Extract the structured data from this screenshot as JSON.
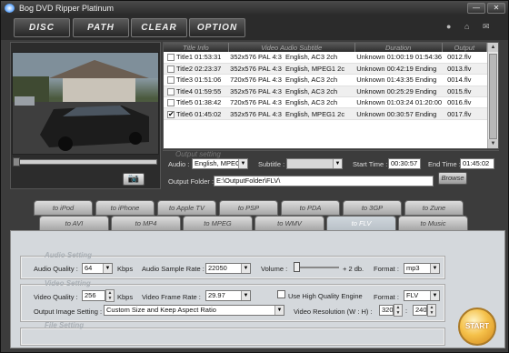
{
  "app": {
    "title": "Bog DVD Ripper Platinum"
  },
  "menu": {
    "disc": "DISC",
    "path": "PATH",
    "clear": "CLEAR",
    "option": "OPTION"
  },
  "table": {
    "headers": [
      "Title Info",
      "Video Audio Subtitle",
      "Duration",
      "Output"
    ],
    "rows": [
      {
        "title": "Title1",
        "time": "01:53:31",
        "video": "352x576 PAL 4:3",
        "audio": "English, AC3 2ch",
        "sub": "Unknown",
        "start": "01:00:19",
        "end": "01:54:36",
        "output": "0012.flv",
        "checked": false,
        "cm": ""
      },
      {
        "title": "Title2",
        "time": "02:23:37",
        "video": "352x576 PAL 4:3",
        "audio": "English, MPEG1 2c",
        "sub": "Unknown",
        "start": "00:42:19",
        "end": "Ending",
        "output": "0013.flv",
        "checked": false,
        "cm": ""
      },
      {
        "title": "Title3",
        "time": "01:51:06",
        "video": "720x576 PAL 4:3",
        "audio": "English, AC3 2ch",
        "sub": "Unknown",
        "start": "01:43:35",
        "end": "Ending",
        "output": "0014.flv",
        "checked": false,
        "cm": ""
      },
      {
        "title": "Title4",
        "time": "01:59:55",
        "video": "352x576 PAL 4:3",
        "audio": "English, AC3 2ch",
        "sub": "Unknown",
        "start": "00:25:29",
        "end": "Ending",
        "output": "0015.flv",
        "checked": false,
        "cm": ""
      },
      {
        "title": "Title5",
        "time": "01:38:42",
        "video": "720x576 PAL 4:3",
        "audio": "English, AC3 2ch",
        "sub": "Unknown",
        "start": "01:03:24",
        "end": "01:20:00",
        "output": "0016.flv",
        "checked": false,
        "cm": ""
      },
      {
        "title": "Title6",
        "time": "01:45:02",
        "video": "352x576 PAL 4:3",
        "audio": "English, MPEG1 2c",
        "sub": "Unknown",
        "start": "00:30:57",
        "end": "Ending",
        "output": "0017.flv",
        "checked": true,
        "cm": "✔"
      }
    ]
  },
  "output_setting": {
    "section": "Output setting",
    "audio_label": "Audio :",
    "audio_value": "English, MPEG1",
    "subtitle_label": "Subtitle :",
    "subtitle_value": "",
    "start_label": "Start Time :",
    "start_value": "00:30:57",
    "end_label": "End Time :",
    "end_value": "01:45:02",
    "folder_label": "Output Folder :",
    "folder_value": "E:\\OutputFolder\\FLV\\",
    "browse": "Browse"
  },
  "tabs_top": [
    "to iPod",
    "to iPhone",
    "to Apple TV",
    "to PSP",
    "to PDA",
    "to 3GP",
    "to Zune"
  ],
  "tabs_bottom": [
    "to AVI",
    "to MP4",
    "to MPEG",
    "to WMV",
    "to FLV",
    "to Music"
  ],
  "active_tab": "to FLV",
  "audio_setting": {
    "section": "Audio Setting",
    "quality_label": "Audio Quality :",
    "quality_value": "64",
    "quality_unit": "Kbps",
    "rate_label": "Audio Sample Rate :",
    "rate_value": "22050",
    "volume_label": "Volume :",
    "volume_value": "+ 2 db.",
    "format_label": "Format :",
    "format_value": "mp3"
  },
  "video_setting": {
    "section": "Video Setting",
    "quality_label": "Video Quality :",
    "quality_value": "256",
    "quality_unit": "Kbps",
    "rate_label": "Video Frame Rate :",
    "rate_value": "29.97",
    "hq_label": "Use High Quality Engine",
    "format_label": "Format :",
    "format_value": "FLV",
    "image_label": "Output Image Setting :",
    "image_value": "Custom Size and Keep Aspect Ratio",
    "res_label": "Video Resolution  (W : H) :",
    "res_w": "320",
    "res_h": "240",
    "file_section": "File Setting"
  },
  "start_button": "START"
}
